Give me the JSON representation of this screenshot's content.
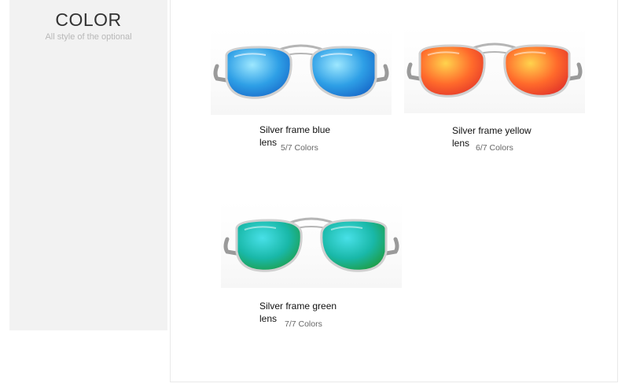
{
  "sidebar": {
    "title": "COLOR",
    "subtitle": "All style of the optional"
  },
  "products": [
    {
      "name": "Silver frame blue lens",
      "count": "5/7 Colors",
      "lens_colors": [
        "#9ee8ff",
        "#2e9fe6",
        "#1565c7"
      ]
    },
    {
      "name": "Silver frame yellow lens",
      "count": "6/7 Colors",
      "lens_colors": [
        "#ffd34d",
        "#ff6a2b",
        "#e0302a"
      ]
    },
    {
      "name": "Silver frame green lens",
      "count": "7/7 Colors",
      "lens_colors": [
        "#48e0e8",
        "#19b8a8",
        "#1f9a3a"
      ]
    }
  ]
}
